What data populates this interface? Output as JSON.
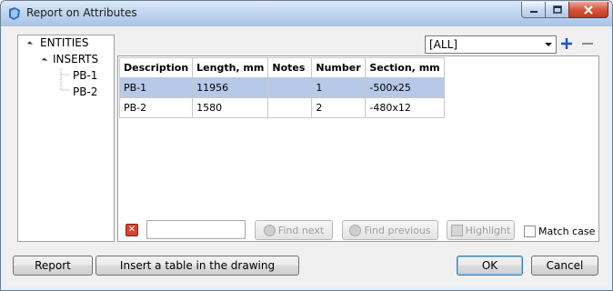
{
  "window": {
    "title": "Report on Attributes",
    "accent": "#3c7fb1"
  },
  "tree": {
    "root": "ENTITIES",
    "child": "INSERTS",
    "leaves": [
      "PB-1",
      "PB-2"
    ]
  },
  "filter": {
    "value": "[ALL]",
    "add_icon": "plus-icon",
    "remove_icon": "minus-icon"
  },
  "table": {
    "columns": [
      "Description",
      "Length, mm",
      "Notes",
      "Number",
      "Section, mm"
    ],
    "rows": [
      [
        "PB-1",
        "11956",
        "",
        "1",
        "-500x25"
      ],
      [
        "PB-2",
        "1580",
        "",
        "2",
        "-480x12"
      ]
    ],
    "selected_row_color": "#b7c9e8"
  },
  "search": {
    "value": "",
    "find_next": "Find next",
    "find_previous": "Find previous",
    "highlight": "Highlight",
    "match_case": "Match case"
  },
  "buttons": {
    "report": "Report",
    "insert_table": "Insert a table in the drawing",
    "ok": "OK",
    "cancel": "Cancel"
  }
}
